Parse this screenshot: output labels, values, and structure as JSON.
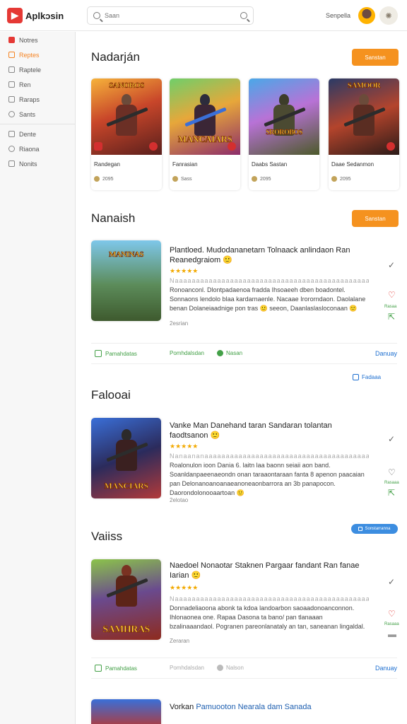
{
  "header": {
    "logo_text": "Aplkɔsin",
    "search_placeholder": "Saan",
    "user_name": "Senpella"
  },
  "sidebar": {
    "items": [
      {
        "label": "Notres"
      },
      {
        "label": "Reptes"
      },
      {
        "label": "Raptele"
      },
      {
        "label": "Ren"
      },
      {
        "label": "Raraps"
      },
      {
        "label": "Sants"
      },
      {
        "label": "Dente"
      },
      {
        "label": "Riaona"
      },
      {
        "label": "Nonits"
      }
    ]
  },
  "sections": {
    "s1": {
      "title": "Nadarján",
      "button": "Sanstan"
    },
    "s2": {
      "title": "Nanaish",
      "button": "Sanstan"
    },
    "s3": {
      "title": "Falooai",
      "link": "Fadaaa"
    },
    "s4": {
      "title": "Vaiiss",
      "pill": "Sonstarranna"
    }
  },
  "cards": [
    {
      "name": "Randegan",
      "meta": "2095",
      "banner": "SANOROS"
    },
    {
      "name": "Fanrasian",
      "meta": "Sass",
      "banner": "MANCAIARS"
    },
    {
      "name": "Daabs Sastan",
      "meta": "2095",
      "banner": "SROROBOS"
    },
    {
      "name": "Daae Sedanmon",
      "meta": "2095",
      "banner": "SAMOOR"
    }
  ],
  "list": [
    {
      "title": "Plantloed. Mudodananetarn Tolnaack anlindaon Ran Reanedgraiom 🙂",
      "stars": "★★★★★",
      "desc_faint": "Naaaaaaaaaaaaaaaaaaaaaaaaaaaaaaaaaaaaaaaaaaaaaaaaaaaaaaa",
      "desc": "Ronoanconl. Dlontpadaenoa fradda Ihsoaeeh dben boadontel. Sonnaons lendolo blaa kardarnaenle. Nacaae Irororndaon. Daolalane benan Dolaneiaadnige pon tras 🙂 seeon, Daanlaslasloconaan 🙂",
      "date": "2esrian",
      "side_label": "Rasaa",
      "thumb_banner": "MANINAS",
      "actions": [
        "Pamahdatas",
        "Pomhdalsdan",
        "Nasan",
        "Danuay"
      ]
    },
    {
      "title": "Vanke Man Danehand taran Sandaran tolantan faodtsanon 🙂",
      "stars": "★★★★★",
      "desc_faint": "Nanaananaaaaaaaaaaaaaaaaaaaaaaaaaaaaaaaaaaaaaaaaaaaaaaaa",
      "desc": "Roalonulon ioon Dania 6. laitn laa baonn seiaii aon band. Soanldanpaeenaeondn onan taraaontaraan fanta 8 apenon paacaian pan Delonanoanoanaeanoneaonbarrora an 3b panapocon. Daorondolonooaartoan 🙂",
      "date": "2elotao",
      "side_label": "Rasaaa",
      "thumb_banner": "MANCIARS"
    },
    {
      "title": "Naedoel Nonaotar Staknen Pargaar fandant Ran fanae Iarian 🙂",
      "title_blue": "Pargaar",
      "stars": "★★★★★",
      "desc_faint": "Naaaaaaaaaaaaaaaaaaaaaaaaaaaaaaaaaaaaaaaaaaaaaaaaaaaaaaa",
      "desc": "Donnadeliaoona abonk ta kdoa landoarbon saoaadonoanconnon. Ihlonaonea one. Rapaa Dasona ta bano/ pan tlanaaan bzalinaaandaol. Pogranen pareonlanataly an tan, saneanan lingaldal.",
      "date": "Zeraran",
      "side_label": "Rasaaa",
      "thumb_banner": "SAMHRAS",
      "actions": [
        "Pamahdatas",
        "Pomhdalsdan",
        "Nalson",
        "Danuay"
      ]
    },
    {
      "title": "Vorkan Pamuooton Nearala dam Sanada",
      "title_blue": "Pamuooton Nearala dam Sanada"
    }
  ]
}
